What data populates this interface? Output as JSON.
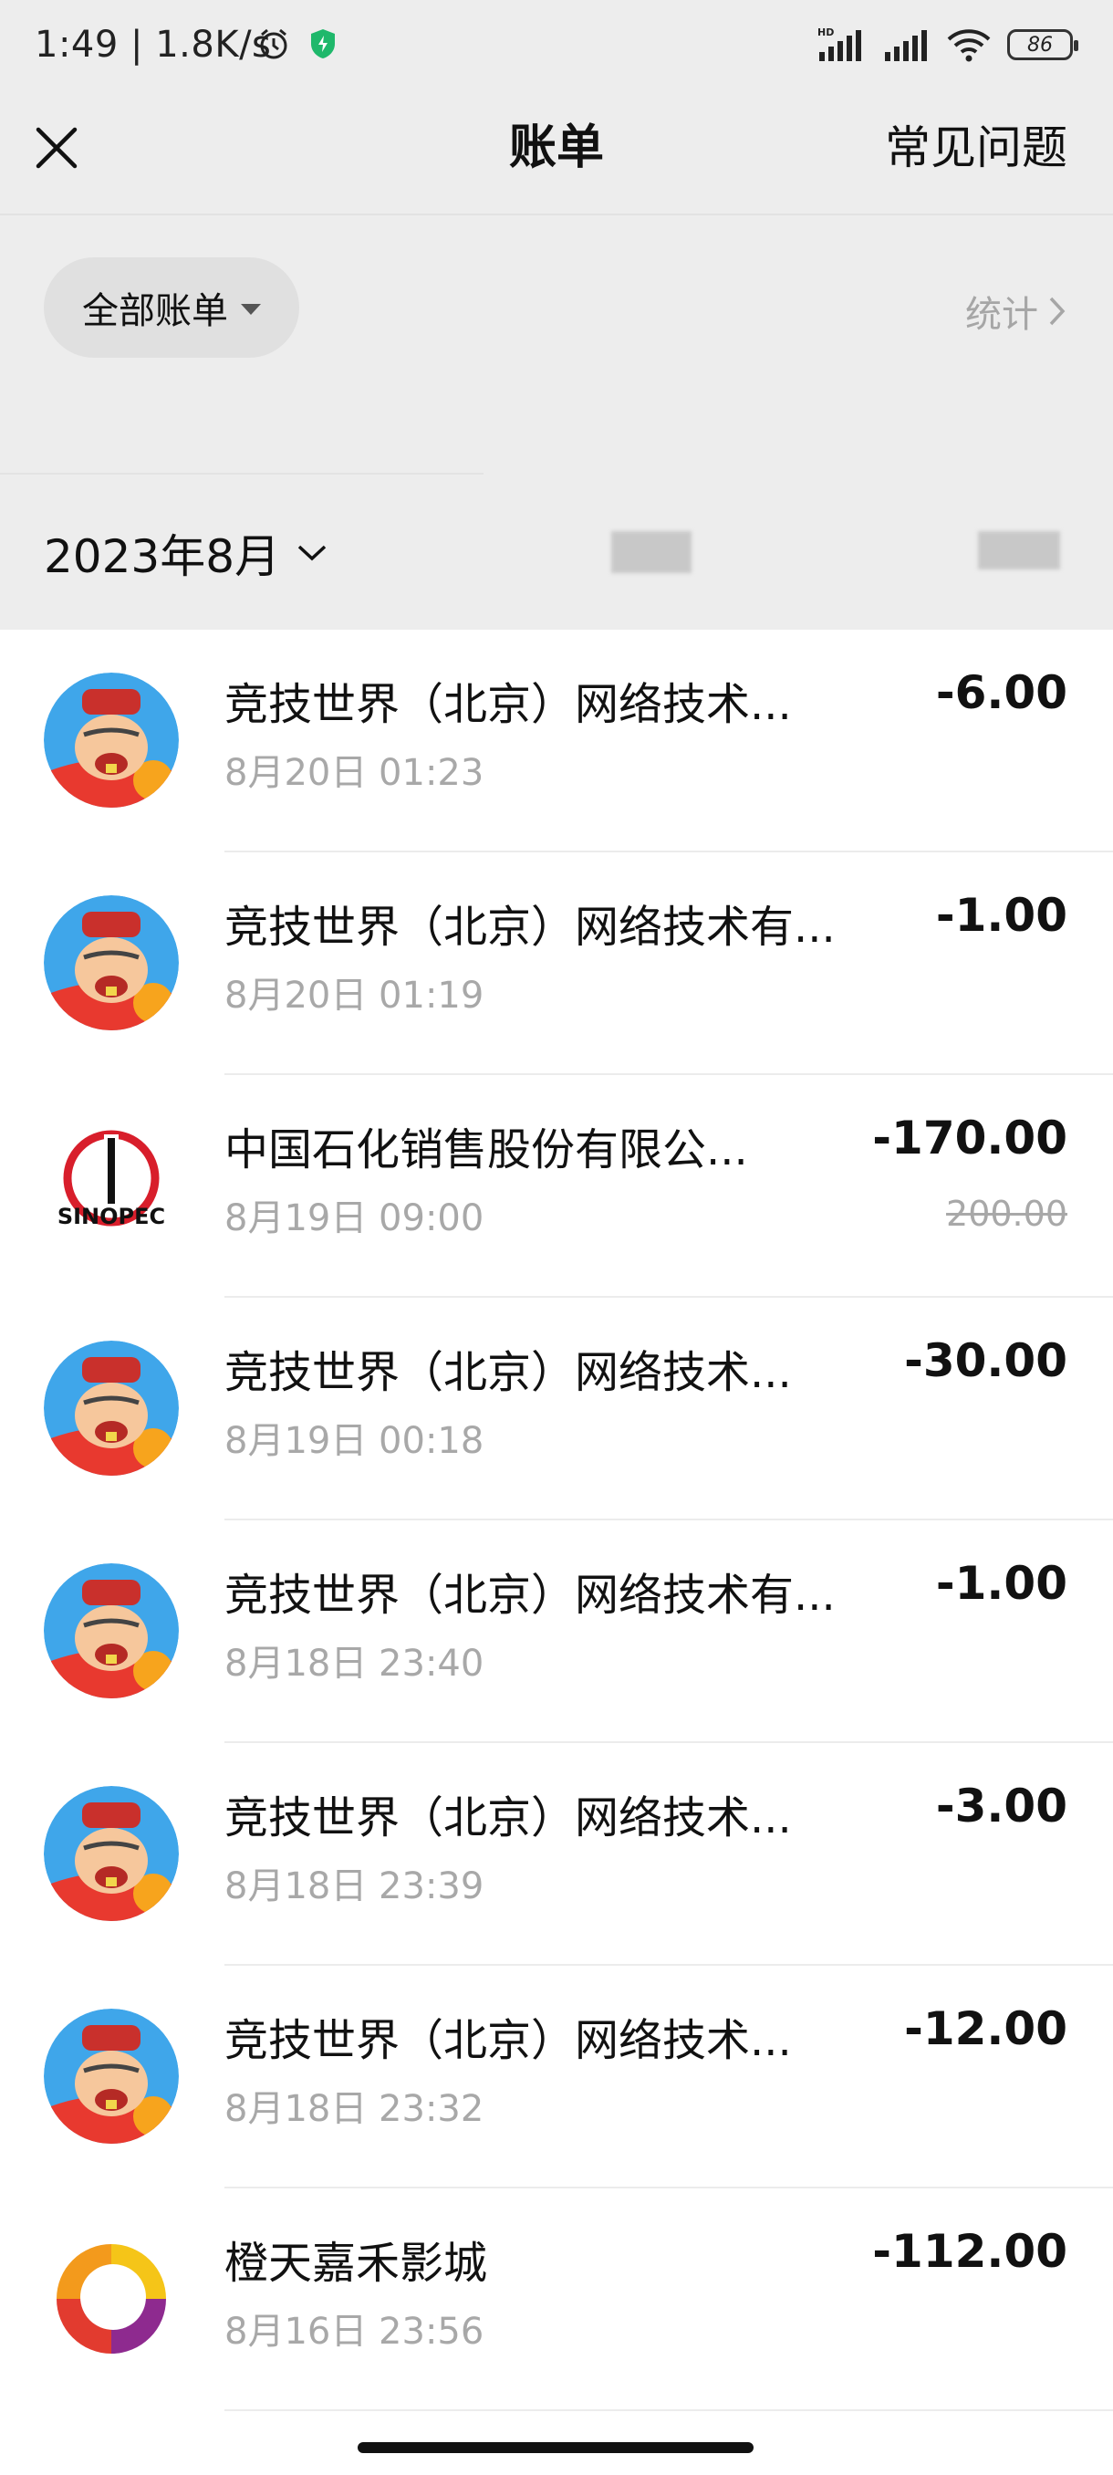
{
  "status_bar": {
    "time_speed": "1:49 | 1.8K/s",
    "battery": "86",
    "network_badge": "HD"
  },
  "header": {
    "title": "账单",
    "faq_label": "常见问题"
  },
  "filter": {
    "label": "全部账单",
    "stats_label": "统计"
  },
  "month_label": "2023年8月",
  "transactions": [
    {
      "merchant": "竞技世界（北京）网络技术...",
      "datetime": "8月20日 01:23",
      "amount": "-6.00",
      "avatar": "game-avatar"
    },
    {
      "merchant": "竞技世界（北京）网络技术有...",
      "datetime": "8月20日 01:19",
      "amount": "-1.00",
      "avatar": "game-avatar"
    },
    {
      "merchant": "中国石化销售股份有限公...",
      "datetime": "8月19日 09:00",
      "amount": "-170.00",
      "original_amount": "200.00",
      "avatar": "sinopec-logo"
    },
    {
      "merchant": "竞技世界（北京）网络技术...",
      "datetime": "8月19日 00:18",
      "amount": "-30.00",
      "avatar": "game-avatar"
    },
    {
      "merchant": "竞技世界（北京）网络技术有...",
      "datetime": "8月18日 23:40",
      "amount": "-1.00",
      "avatar": "game-avatar"
    },
    {
      "merchant": "竞技世界（北京）网络技术...",
      "datetime": "8月18日 23:39",
      "amount": "-3.00",
      "avatar": "game-avatar"
    },
    {
      "merchant": "竞技世界（北京）网络技术...",
      "datetime": "8月18日 23:32",
      "amount": "-12.00",
      "avatar": "game-avatar"
    },
    {
      "merchant": "橙天嘉禾影城",
      "datetime": "8月16日 23:56",
      "amount": "-112.00",
      "avatar": "cinema-logo"
    }
  ],
  "icons": {
    "close": "close-icon",
    "alarm": "alarm-icon",
    "shield": "shield-icon",
    "signal": "signal-icon",
    "wifi": "wifi-icon",
    "caret": "caret-down-icon",
    "chevron_right": "chevron-right-icon",
    "chevron_down": "chevron-down-icon"
  }
}
